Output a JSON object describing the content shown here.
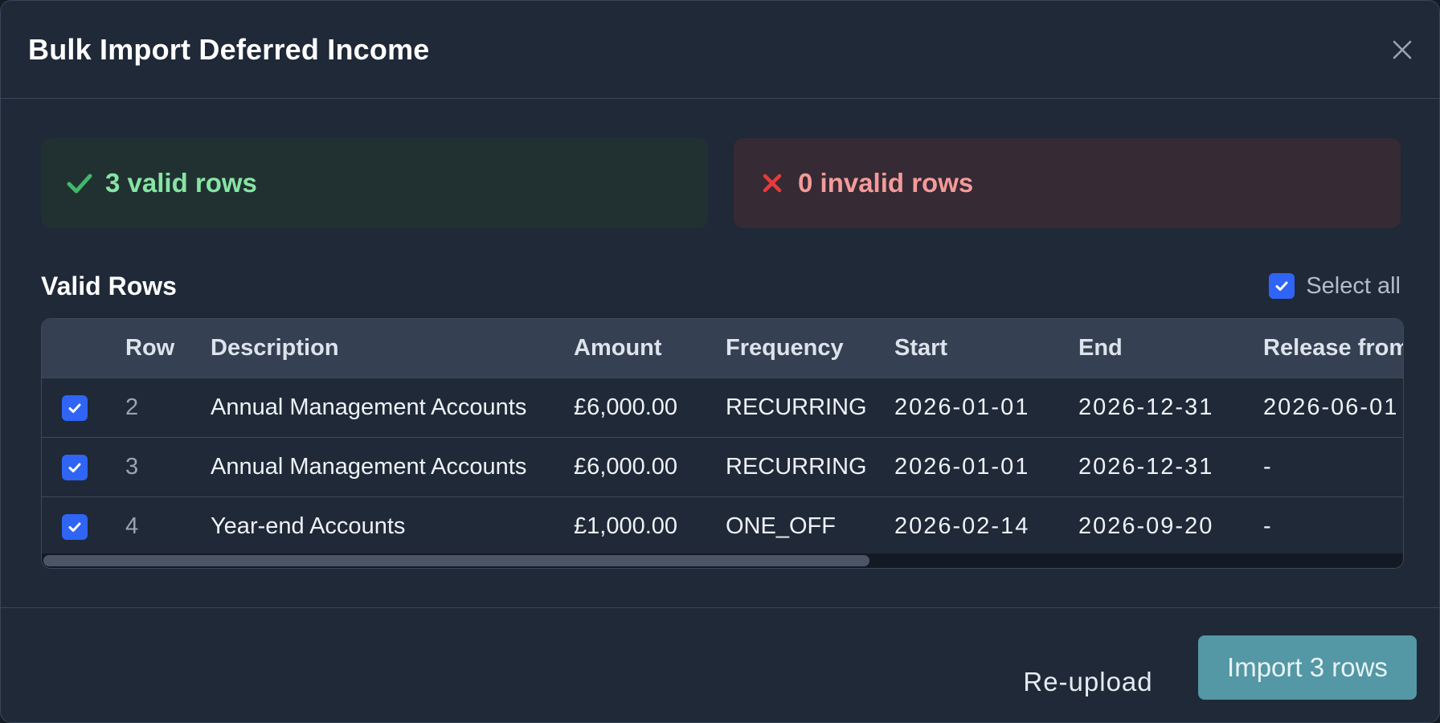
{
  "dialog": {
    "title": "Bulk Import Deferred Income"
  },
  "summary": {
    "valid_label": "3 valid rows",
    "invalid_label": "0 invalid rows"
  },
  "valid_rows": {
    "section_title": "Valid Rows",
    "select_all_label": "Select all",
    "select_all_checked": true,
    "columns": [
      "Row",
      "Description",
      "Amount",
      "Frequency",
      "Start",
      "End",
      "Release from"
    ],
    "rows": [
      {
        "checked": true,
        "row": "2",
        "description": "Annual Management Accounts",
        "amount": "£6,000.00",
        "frequency": "RECURRING",
        "start": "2026-01-01",
        "end": "2026-12-31",
        "release_from": "2026-06-01"
      },
      {
        "checked": true,
        "row": "3",
        "description": "Annual Management Accounts",
        "amount": "£6,000.00",
        "frequency": "RECURRING",
        "start": "2026-01-01",
        "end": "2026-12-31",
        "release_from": "-"
      },
      {
        "checked": true,
        "row": "4",
        "description": "Year-end Accounts",
        "amount": "£1,000.00",
        "frequency": "ONE_OFF",
        "start": "2026-02-14",
        "end": "2026-09-20",
        "release_from": "-"
      }
    ]
  },
  "footer": {
    "reupload_label": "Re-upload",
    "import_label": "Import 3 rows"
  },
  "colors": {
    "accent_blue": "#2f64f5",
    "valid_green": "#86e5a4",
    "invalid_red": "#f49a9a",
    "import_button": "#5497a5"
  }
}
